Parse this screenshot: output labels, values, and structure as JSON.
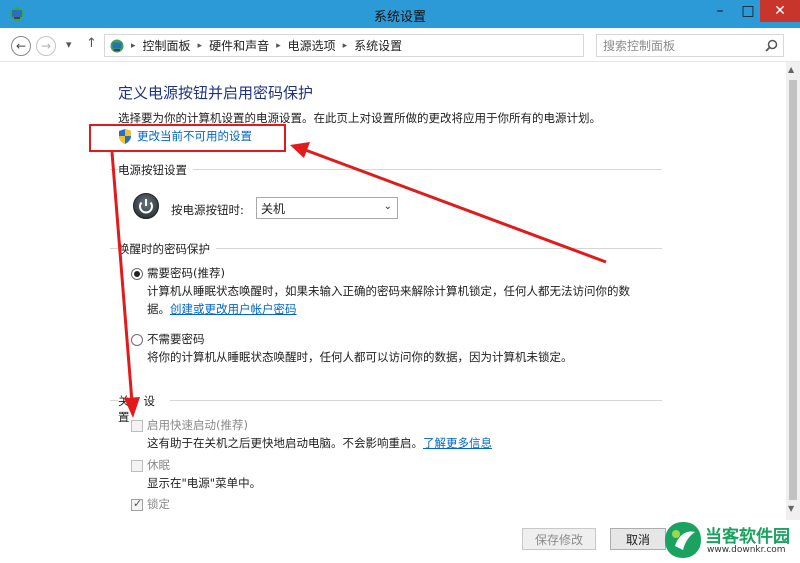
{
  "window": {
    "title": "系统设置",
    "minimize_glyph": "–",
    "maximize_glyph": "□",
    "close_glyph": "✕"
  },
  "address_bar": {
    "back_glyph": "←",
    "forward_glyph": "→",
    "recent_glyph": "▾",
    "up_glyph": "↑",
    "crumbs": [
      "控制面板",
      "硬件和声音",
      "电源选项",
      "系统设置"
    ],
    "crumb_separator": "▸",
    "dropdown_glyph": "⌄",
    "refresh_glyph": "↻",
    "search_placeholder": "搜索控制面板"
  },
  "page": {
    "title": "定义电源按钮并启用密码保护",
    "description": "选择要为你的计算机设置的电源设置。在此页上对设置所做的更改将应用于你所有的电源计划。",
    "change_settings_link": "更改当前不可用的设置"
  },
  "power_buttons": {
    "group_title": "电源按钮设置",
    "label": "按电源按钮时:",
    "selected": "关机"
  },
  "wake_password": {
    "group_title": "唤醒时的密码保护",
    "require": {
      "label": "需要密码(推荐)",
      "text1": "计算机从睡眠状态唤醒时，如果未输入正确的密码来解除计算机锁定，任何人都无法访问你的数",
      "text2_prefix": "据。",
      "text2_link": "创建或更改用户帐户密码",
      "checked": true
    },
    "no_require": {
      "label": "不需要密码",
      "text": "将你的计算机从睡眠状态唤醒时，任何人都可以访问你的数据，因为计算机未锁定。",
      "checked": false
    }
  },
  "shutdown": {
    "group_title_left": "关",
    "group_title_right": "设置",
    "fast_startup": {
      "label": "启用快速启动(推荐)",
      "text_prefix": "这有助于在关机之后更快地启动电脑。不会影响重启。",
      "text_link": "了解更多信息",
      "checked": false
    },
    "sleep": {
      "label": "休眠",
      "text": "显示在\"电源\"菜单中。",
      "checked": false
    },
    "lock": {
      "label": "锁定",
      "checked": true
    }
  },
  "footer": {
    "save_label": "保存修改",
    "cancel_label": "取消"
  },
  "watermark": {
    "name": "当客软件园",
    "url": "www.downkr.com"
  },
  "colors": {
    "titlebar": "#2d9ad8",
    "heading": "#1e3287",
    "link": "#0066cc",
    "annotation_red": "#e11b1b",
    "close_button": "#c7352b"
  }
}
